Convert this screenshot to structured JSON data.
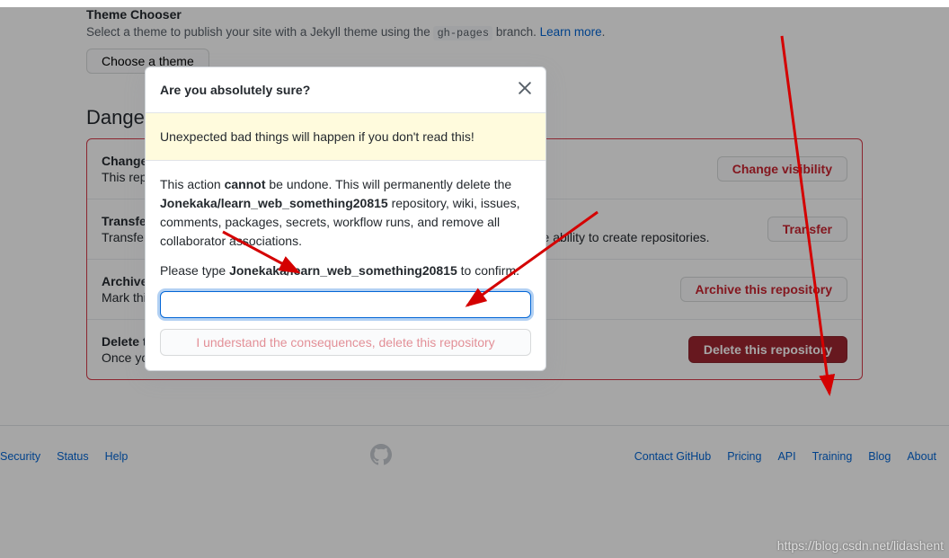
{
  "theme": {
    "heading": "Theme Chooser",
    "desc_prefix": "Select a theme to publish your site with a Jekyll theme using the ",
    "branch": "gh-pages",
    "desc_suffix": " branch. ",
    "learn_more": "Learn more",
    "button": "Choose a theme"
  },
  "danger_heading": "Danger Zone",
  "rows": [
    {
      "title": "Change repository visibility",
      "desc": "This repository is currently public.",
      "button": "Change visibility"
    },
    {
      "title": "Transfer ownership",
      "desc": "Transfer this repository to another user or to an organization where you have the ability to create repositories.",
      "button": "Transfer"
    },
    {
      "title": "Archive this repository",
      "desc": "Mark this repository as archived and read-only.",
      "button": "Archive this repository"
    },
    {
      "title": "Delete this repository",
      "desc": "Once you delete a repository, there is no going back. Please be certain.",
      "button": "Delete this repository"
    }
  ],
  "footer": {
    "left": [
      "Security",
      "Status",
      "Help"
    ],
    "right": [
      "Contact GitHub",
      "Pricing",
      "API",
      "Training",
      "Blog",
      "About"
    ]
  },
  "modal": {
    "title": "Are you absolutely sure?",
    "warning": "Unexpected bad things will happen if you don't read this!",
    "body_prefix": "This action ",
    "cannot": "cannot",
    "body_mid": " be undone. This will permanently delete the ",
    "repo": "Jonekaka/learn_web_something20815",
    "body_suffix": " repository, wiki, issues, comments, packages, secrets, workflow runs, and remove all collaborator associations.",
    "type_prefix": "Please type ",
    "type_suffix": " to confirm.",
    "confirm_button": "I understand the consequences, delete this repository"
  },
  "watermark": "https://blog.csdn.net/lidashent"
}
